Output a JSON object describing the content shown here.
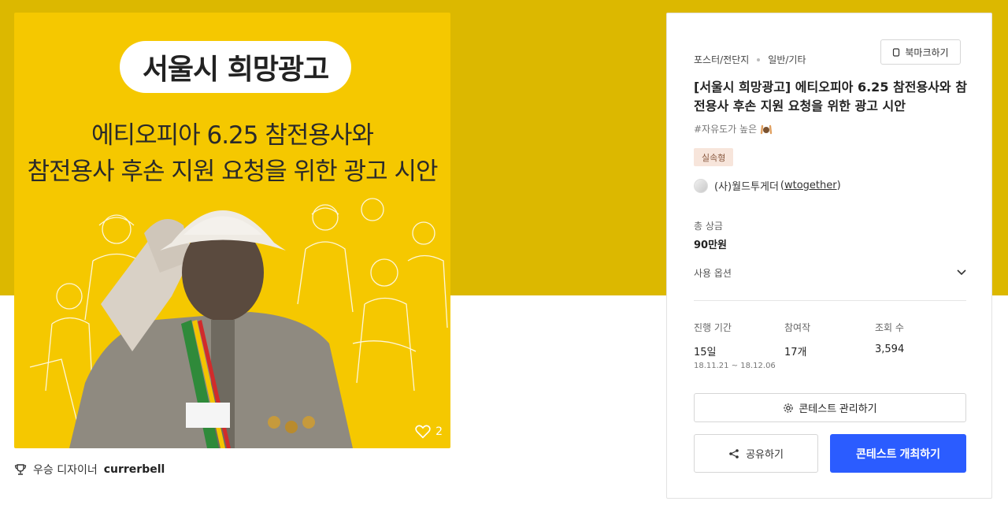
{
  "poster": {
    "heading": "서울시 희망광고",
    "subtitle_line1": "에티오피아 6.25 참전용사와",
    "subtitle_line2": "참전용사 후손 지원 요청을 위한 광고 시안",
    "like_count": "2",
    "like_icon": "heart-icon"
  },
  "winner": {
    "icon": "trophy-icon",
    "label": "우승 디자이너",
    "name": "currerbell"
  },
  "panel": {
    "category_primary": "포스터/전단지",
    "category_secondary": "일반/기타",
    "bookmark_label": "북마크하기",
    "title": "[서울시 희망광고] 에티오피아 6.25 참전용사와 참전용사 후손 지원 요청을 위한 광고 시안",
    "tagline": "#자유도가 높은",
    "type_badge": "실속형",
    "host_name": "(사)월드투게더",
    "host_id": "wtogether",
    "prize_label": "총 상금",
    "prize_value": "90만원",
    "option_label": "사용 옵션",
    "stats": {
      "period_label": "진행 기간",
      "period_value": "15일",
      "period_range": "18.11.21 ~ 18.12.06",
      "entries_label": "참여작",
      "entries_value": "17개",
      "views_label": "조회 수",
      "views_value": "3,594"
    },
    "manage_label": "콘테스트 관리하기",
    "share_label": "공유하기",
    "host_contest_label": "콘테스트 개최하기"
  },
  "colors": {
    "hero_bg": "#dcb800",
    "poster_bg": "#f5c800",
    "primary_button": "#2b5cff",
    "badge_bg": "#f7e5db"
  }
}
